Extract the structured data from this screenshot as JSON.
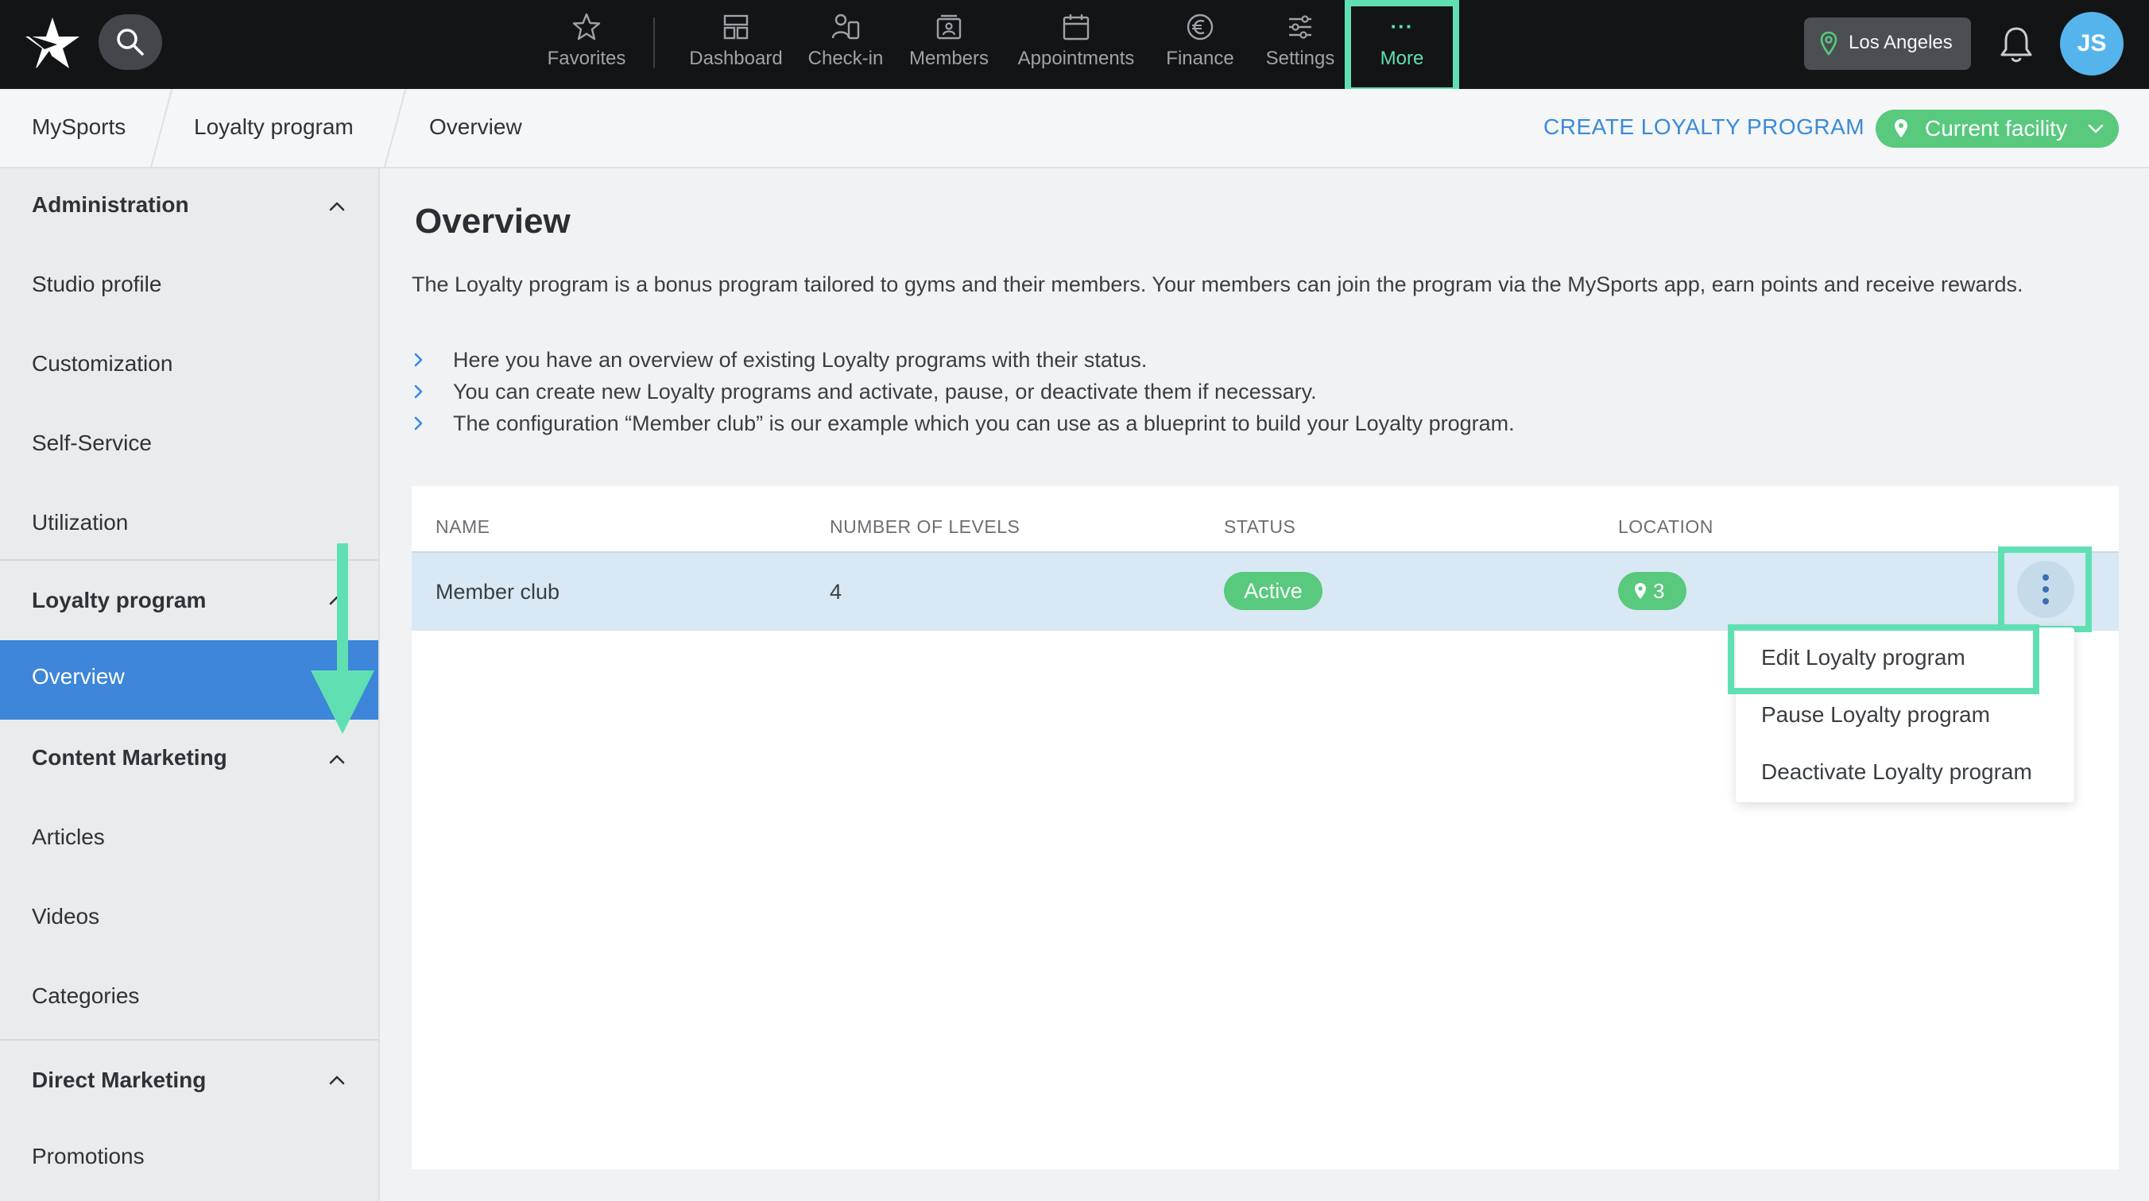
{
  "app": {
    "brand_color": "#60e0b2",
    "accent_color": "#3d86d9",
    "status_color": "#58c97d"
  },
  "topnav": {
    "items": [
      {
        "label": "Favorites",
        "icon": "star-icon"
      },
      {
        "label": "Dashboard",
        "icon": "dashboard-icon"
      },
      {
        "label": "Check-in",
        "icon": "check-in-icon"
      },
      {
        "label": "Members",
        "icon": "members-icon"
      },
      {
        "label": "Appointments",
        "icon": "calendar-icon"
      },
      {
        "label": "Finance",
        "icon": "euro-icon"
      },
      {
        "label": "Settings",
        "icon": "sliders-icon"
      }
    ],
    "more": {
      "label": "More",
      "icon": "dots-icon",
      "highlighted": true
    },
    "location": "Los Angeles",
    "avatar_initials": "JS"
  },
  "breadcrumb": {
    "items": [
      "MySports",
      "Loyalty program",
      "Overview"
    ],
    "create_label": "CREATE LOYALTY PROGRAM",
    "facility_label": "Current facility"
  },
  "sidebar": {
    "groups": [
      {
        "label": "Administration",
        "items": [
          "Studio profile",
          "Customization",
          "Self-Service",
          "Utilization"
        ]
      },
      {
        "label": "Loyalty program",
        "items": [
          "Overview"
        ],
        "active": "Overview"
      },
      {
        "label": "Content Marketing",
        "items": [
          "Articles",
          "Videos",
          "Categories"
        ]
      },
      {
        "label": "Direct Marketing",
        "items": [
          "Promotions"
        ]
      }
    ]
  },
  "main": {
    "title": "Overview",
    "intro": "The Loyalty program is a bonus program tailored to gyms and their members. Your members can join the program via the MySports app, earn points and receive rewards.",
    "bullets": [
      "Here you have an overview of existing Loyalty programs with their status.",
      "You can create new Loyalty programs and activate, pause, or deactivate them if necessary.",
      "The configuration “Member club” is our example which you can use as a blueprint to build your Loyalty program."
    ],
    "table": {
      "columns": [
        "NAME",
        "NUMBER OF LEVELS",
        "STATUS",
        "LOCATION"
      ],
      "rows": [
        {
          "name": "Member club",
          "levels": "4",
          "status": "Active",
          "location": "3"
        }
      ]
    },
    "menu": {
      "items": [
        "Edit Loyalty program",
        "Pause Loyalty program",
        "Deactivate Loyalty program"
      ],
      "highlighted": "Edit Loyalty program"
    }
  }
}
